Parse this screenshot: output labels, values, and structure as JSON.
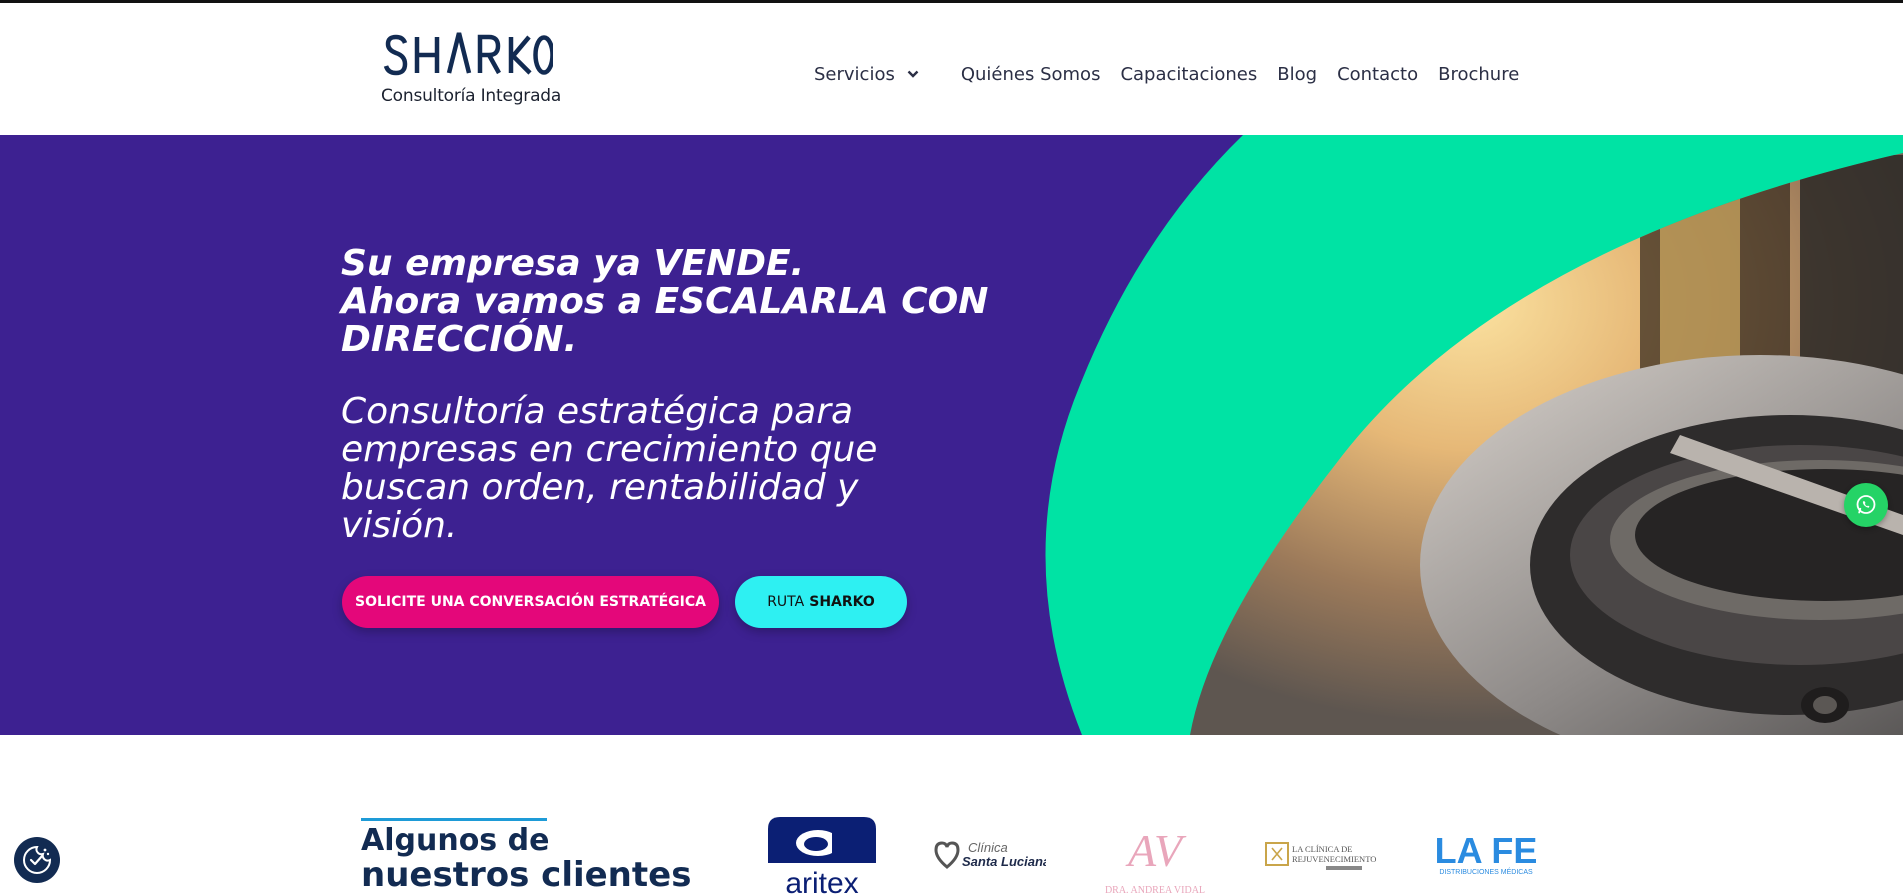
{
  "brand": {
    "logo_text": "SHΛRKO",
    "tagline": "Consultoría Integrada"
  },
  "nav": {
    "items": [
      "Servicios",
      "Quiénes Somos",
      "Capacitaciones",
      "Blog",
      "Contacto",
      "Brochure"
    ]
  },
  "hero": {
    "title_lines": [
      "Su empresa ya VENDE.",
      "Ahora vamos a ESCALARLA CON",
      "DIRECCIÓN."
    ],
    "subtitle_lines": [
      "Consultoría estratégica para",
      "empresas en crecimiento que",
      "buscan orden, rentabilidad y",
      "visión."
    ],
    "cta_primary": "SOLICITE UNA CONVERSACIÓN ESTRATÉGICA",
    "cta_secondary_prefix": "RUTA",
    "cta_secondary_bold": "SHARKO"
  },
  "clients": {
    "heading_line1": "Algunos de",
    "heading_line2": "nuestros clientes",
    "logos": {
      "aritex": "aritex",
      "luciana_line1": "Clínica",
      "luciana_line2": "Santa Luciana",
      "andrea_mark": "AV",
      "andrea_name": "DRA. ANDREA VIDAL",
      "clinica_line1": "LA CLÍNICA DE",
      "clinica_line2": "REJUVENECIMIENTO",
      "lafe_main": "LA FE",
      "lafe_sub": "DISTRIBUCIONES MÉDICAS"
    }
  },
  "colors": {
    "hero_bg": "#3d2191",
    "accent_green": "#00e3a4",
    "primary_button": "#e4077a",
    "secondary_button": "#2ef0f2",
    "navy": "#122b52"
  },
  "icons": {
    "nav_dropdown": "chevron-down-icon",
    "whatsapp": "whatsapp-icon",
    "cookie": "cookie-settings-icon"
  }
}
